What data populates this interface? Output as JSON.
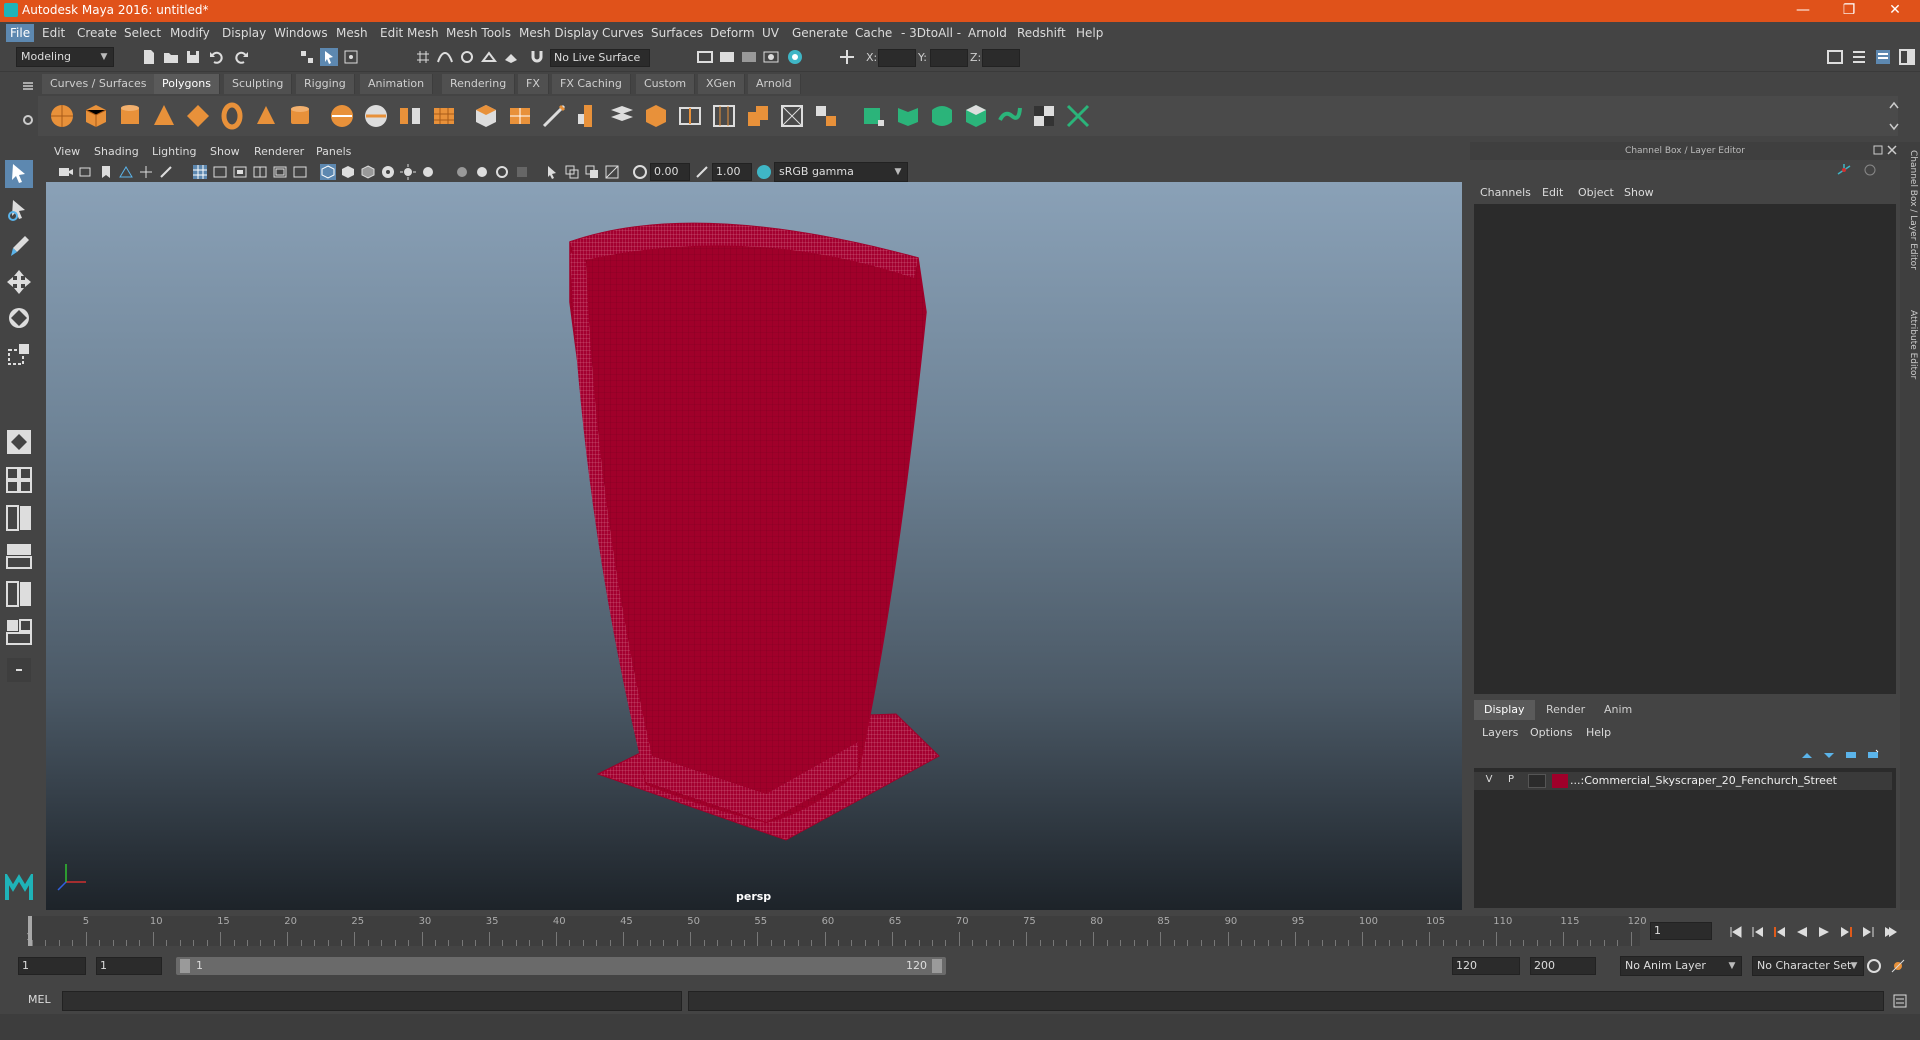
{
  "window": {
    "title": "Autodesk Maya 2016: untitled*",
    "controls": [
      "—",
      "❐",
      "✕"
    ]
  },
  "menubar": {
    "items": [
      "File",
      "Edit",
      "Create",
      "Select",
      "Modify",
      "Display",
      "Windows",
      "Mesh",
      "Edit Mesh",
      "Mesh Tools",
      "Mesh Display",
      "Curves",
      "Surfaces",
      "Deform",
      "UV",
      "Generate",
      "Cache",
      "- 3DtoAll -",
      "Arnold",
      "Redshift",
      "Help"
    ]
  },
  "statusline": {
    "mode": "Modeling",
    "live_surface": "No Live Surface",
    "x_label": "X:",
    "y_label": "Y:",
    "z_label": "Z:"
  },
  "shelf": {
    "tabs": [
      "Curves / Surfaces",
      "Polygons",
      "Sculpting",
      "Rigging",
      "Animation",
      "Rendering",
      "FX",
      "FX Caching",
      "Custom",
      "XGen",
      "Arnold"
    ],
    "active_tab": "Polygons"
  },
  "viewport": {
    "menus": [
      "View",
      "Shading",
      "Lighting",
      "Show",
      "Renderer",
      "Panels"
    ],
    "exposure": "0.00",
    "gamma": "1.00",
    "color_space": "sRGB gamma",
    "camera": "persp",
    "mesh_color": "#a0002a"
  },
  "channelbox": {
    "title": "Channel Box / Layer Editor",
    "menus": [
      "Channels",
      "Edit",
      "Object",
      "Show"
    ],
    "layer_tabs": [
      "Display",
      "Render",
      "Anim"
    ],
    "active_layer_tab": "Display",
    "layer_menus": [
      "Layers",
      "Options",
      "Help"
    ],
    "layer": {
      "v": "V",
      "p": "P",
      "name": "...:Commercial_Skyscraper_20_Fenchurch_Street",
      "color": "#a0002a"
    }
  },
  "sidetabs": [
    "Channel Box / Layer Editor",
    "Attribute Editor"
  ],
  "timeline": {
    "labels": [
      "5",
      "10",
      "15",
      "20",
      "25",
      "30",
      "35",
      "40",
      "45",
      "50",
      "55",
      "60",
      "65",
      "70",
      "75",
      "80",
      "85",
      "90",
      "95",
      "100",
      "105",
      "110",
      "115",
      "120"
    ],
    "start_label": "1",
    "current_frame": "1"
  },
  "range": {
    "start": "1",
    "playback_start": "1",
    "slider_start": "1",
    "slider_end": "120",
    "playback_end": "120",
    "end": "200",
    "anim_layer": "No Anim Layer",
    "character_set": "No Character Set"
  },
  "cmdline": {
    "label": "MEL"
  }
}
